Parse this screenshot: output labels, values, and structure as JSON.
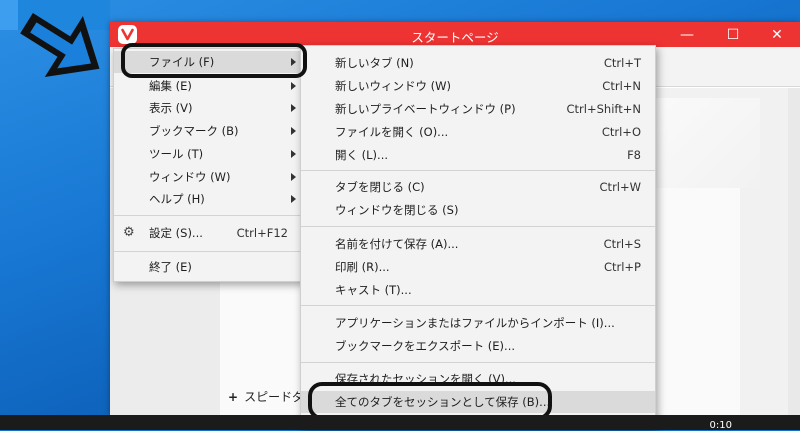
{
  "window": {
    "title": "スタートページ",
    "accent_color": "#ee3333",
    "controls": {
      "minimize": "—",
      "maximize": "☐",
      "close": "✕"
    }
  },
  "page": {
    "speed_dial_label": "スピードダイ",
    "speed_dial_plus": "+"
  },
  "main_menu": {
    "items": [
      {
        "label": "ファイル (F)",
        "has_submenu": true,
        "highlighted": true
      },
      {
        "label": "編集 (E)",
        "has_submenu": true
      },
      {
        "label": "表示 (V)",
        "has_submenu": true
      },
      {
        "label": "ブックマーク (B)",
        "has_submenu": true
      },
      {
        "label": "ツール (T)",
        "has_submenu": true
      },
      {
        "label": "ウィンドウ (W)",
        "has_submenu": true
      },
      {
        "label": "ヘルプ (H)",
        "has_submenu": true
      },
      {
        "label": "設定 (S)...",
        "shortcut": "Ctrl+F12",
        "icon": "gear-icon"
      },
      {
        "label": "終了 (E)"
      }
    ]
  },
  "file_menu": {
    "items": [
      {
        "label": "新しいタブ (N)",
        "shortcut": "Ctrl+T"
      },
      {
        "label": "新しいウィンドウ (W)",
        "shortcut": "Ctrl+N"
      },
      {
        "label": "新しいプライベートウィンドウ (P)",
        "shortcut": "Ctrl+Shift+N"
      },
      {
        "label": "ファイルを開く (O)...",
        "shortcut": "Ctrl+O"
      },
      {
        "label": "開く (L)...",
        "shortcut": "F8"
      },
      {
        "label": "タブを閉じる (C)",
        "shortcut": "Ctrl+W"
      },
      {
        "label": "ウィンドウを閉じる (S)",
        "shortcut": ""
      },
      {
        "label": "名前を付けて保存 (A)...",
        "shortcut": "Ctrl+S"
      },
      {
        "label": "印刷 (R)...",
        "shortcut": "Ctrl+P"
      },
      {
        "label": "キャスト (T)...",
        "shortcut": ""
      },
      {
        "label": "アプリケーションまたはファイルからインポート (I)...",
        "shortcut": ""
      },
      {
        "label": "ブックマークをエクスポート (E)...",
        "shortcut": ""
      },
      {
        "label": "保存されたセッションを開く (V)...",
        "shortcut": ""
      },
      {
        "label": "全てのタブをセッションとして保存 (B)...",
        "shortcut": "",
        "highlighted": true
      }
    ]
  },
  "taskbar": {
    "time": "0:10"
  }
}
